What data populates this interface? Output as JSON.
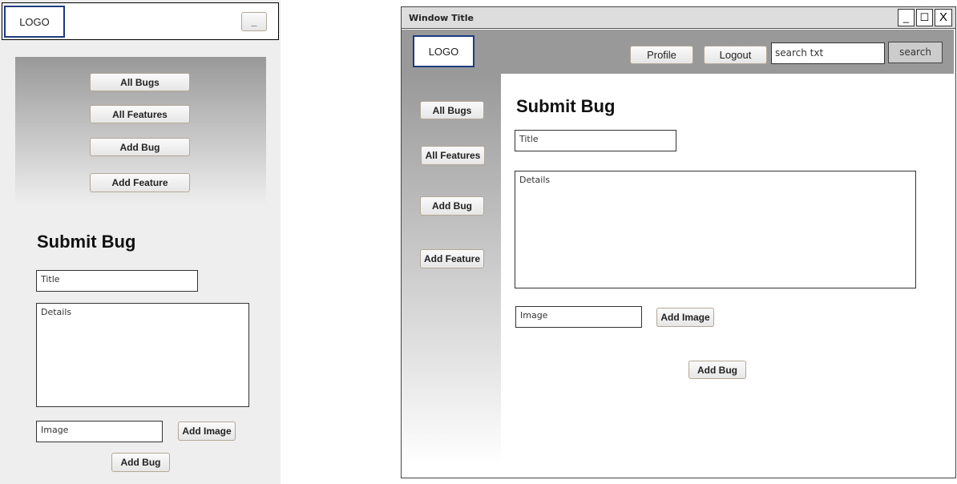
{
  "mobile": {
    "logo": "LOGO",
    "menu_button": "_",
    "nav": [
      "All Bugs",
      "All Features",
      "Add Bug",
      "Add Feature"
    ],
    "heading": "Submit Bug",
    "title_placeholder": "Title",
    "details_placeholder": "Details",
    "image_placeholder": "Image",
    "add_image": "Add Image",
    "add_bug": "Add Bug"
  },
  "desktop": {
    "window_title": "Window Title",
    "window_controls": {
      "minimize": "_",
      "maximize": "☐",
      "close": "X"
    },
    "logo": "LOGO",
    "profile": "Profile",
    "logout": "Logout",
    "search_value": "search txt",
    "search_button": "search",
    "nav": [
      "All Bugs",
      "All Features",
      "Add Bug",
      "Add Feature"
    ],
    "heading": "Submit Bug",
    "title_placeholder": "Title",
    "details_placeholder": "Details",
    "image_placeholder": "Image",
    "add_image": "Add Image",
    "add_bug": "Add Bug"
  }
}
